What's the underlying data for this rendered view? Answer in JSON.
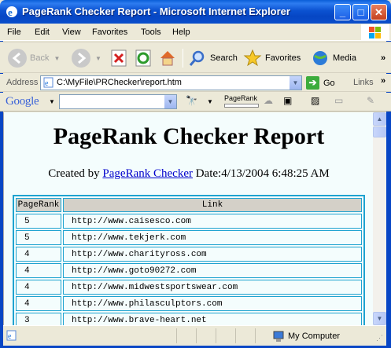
{
  "window": {
    "title": "PageRank Checker Report - Microsoft Internet Explorer",
    "min_glyph": "_",
    "max_glyph": "□",
    "close_glyph": "✕"
  },
  "menu": [
    "File",
    "Edit",
    "View",
    "Favorites",
    "Tools",
    "Help"
  ],
  "toolbar": {
    "back_label": "Back",
    "search_label": "Search",
    "favorites_label": "Favorites",
    "media_label": "Media"
  },
  "address": {
    "label": "Address",
    "url": "C:\\MyFile\\PRChecker\\report.htm",
    "go_label": "Go",
    "links_label": "Links"
  },
  "google_bar": {
    "logo": "Google",
    "search_value": "",
    "pagerank_label": "PageRank"
  },
  "report": {
    "title": "PageRank Checker Report",
    "created_prefix": "Created by ",
    "created_link": "PageRank Checker",
    "created_suffix": " Date:4/13/2004 6:48:25 AM",
    "columns": [
      "PageRank",
      "Link"
    ],
    "rows": [
      {
        "rank": "5",
        "link": "http://www.caisesco.com"
      },
      {
        "rank": "5",
        "link": "http://www.tekjerk.com"
      },
      {
        "rank": "4",
        "link": "http://www.charityross.com"
      },
      {
        "rank": "4",
        "link": "http://www.goto90272.com"
      },
      {
        "rank": "4",
        "link": "http://www.midwestsportswear.com"
      },
      {
        "rank": "4",
        "link": "http://www.philasculptors.com"
      },
      {
        "rank": "3",
        "link": "http://www.brave-heart.net"
      }
    ]
  },
  "status": {
    "zone_label": "My Computer"
  }
}
